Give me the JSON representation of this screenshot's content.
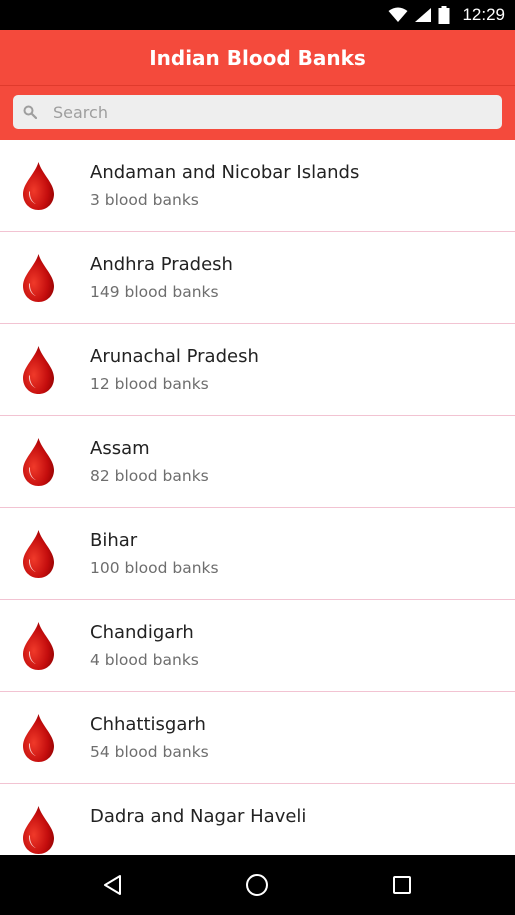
{
  "status_bar": {
    "time": "12:29",
    "icons": [
      "wifi-icon",
      "signal-icon",
      "battery-icon"
    ]
  },
  "app_bar": {
    "title": "Indian Blood Banks",
    "color": "#f44a3c"
  },
  "search": {
    "placeholder": "Search",
    "value": ""
  },
  "list": {
    "items": [
      {
        "name": "Andaman and Nicobar Islands",
        "count": "3 blood banks"
      },
      {
        "name": "Andhra Pradesh",
        "count": "149 blood banks"
      },
      {
        "name": "Arunachal Pradesh",
        "count": "12 blood banks"
      },
      {
        "name": "Assam",
        "count": "82 blood banks"
      },
      {
        "name": "Bihar",
        "count": "100 blood banks"
      },
      {
        "name": "Chandigarh",
        "count": "4 blood banks"
      },
      {
        "name": "Chhattisgarh",
        "count": "54 blood banks"
      },
      {
        "name": "Dadra and Nagar Haveli",
        "count": ""
      }
    ],
    "icon": "blood-drop-icon",
    "divider_color": "#f2c3d2"
  },
  "nav_bar": {
    "icons": [
      "back-icon",
      "home-icon",
      "recents-icon"
    ]
  }
}
